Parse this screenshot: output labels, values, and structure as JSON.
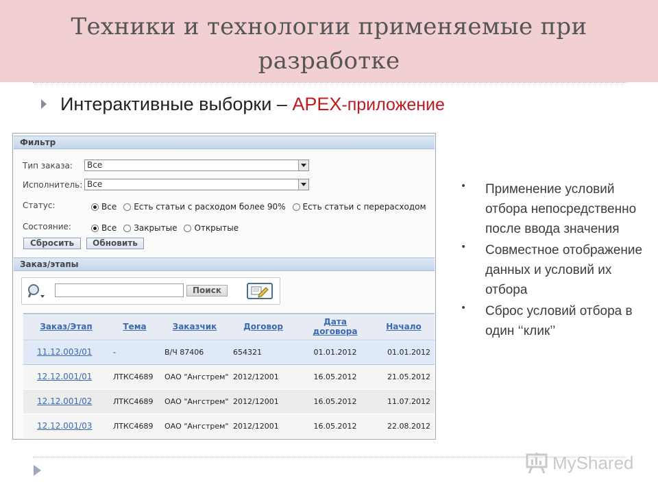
{
  "slide": {
    "title": "Техники и технологии применяемые при разработке",
    "bullet_prefix": "Интерактивные выборки – ",
    "bullet_apex": "APEX",
    "bullet_suffix": "-приложение"
  },
  "filter": {
    "header": "Фильтр",
    "order_type_label": "Тип заказа:",
    "order_type_value": "Все",
    "executor_label": "Исполнитель:",
    "executor_value": "Все",
    "status_label": "Статус:",
    "status_options": [
      "Все",
      "Есть статьи с расходом более 90%",
      "Есть статьи с перерасходом"
    ],
    "status_selected": 0,
    "state_label": "Состояние:",
    "state_options": [
      "Все",
      "Закрытые",
      "Открытые"
    ],
    "state_selected": 0,
    "reset_label": "Сбросить",
    "refresh_label": "Обновить"
  },
  "orders": {
    "header": "Заказ/этапы",
    "search_button": "Поиск",
    "columns": [
      "Заказ/Этап",
      "Тема",
      "Заказчик",
      "Договор",
      "Дата договора",
      "Начало"
    ],
    "rows": [
      [
        "11.12.003/01",
        "-",
        "В/Ч 87406",
        "654321",
        "01.01.2012",
        "01.01.2012"
      ],
      [
        "12.12.001/01",
        "ЛТКС4689",
        "ОАО \"Ангстрем\"",
        "2012/12001",
        "16.05.2012",
        "21.05.2012"
      ],
      [
        "12.12.001/02",
        "ЛТКС4689",
        "ОАО \"Ангстрем\"",
        "2012/12001",
        "16.05.2012",
        "11.07.2012"
      ],
      [
        "12.12.001/03",
        "ЛТКС4689",
        "ОАО \"Ангстрем\"",
        "2012/12001",
        "16.05.2012",
        "22.08.2012"
      ]
    ]
  },
  "side_points": [
    "Применение условий отбора непосредственно после ввода значения",
    "Совместное отображение данных и условий их отбора",
    "Сброс условий отбора в один ‘‘клик’’"
  ],
  "footer": {
    "logo_text": "MyShared"
  },
  "colors": {
    "title_band": "#f2cfd0",
    "apex_red": "#c0191f",
    "link_blue": "#3a69b2"
  }
}
